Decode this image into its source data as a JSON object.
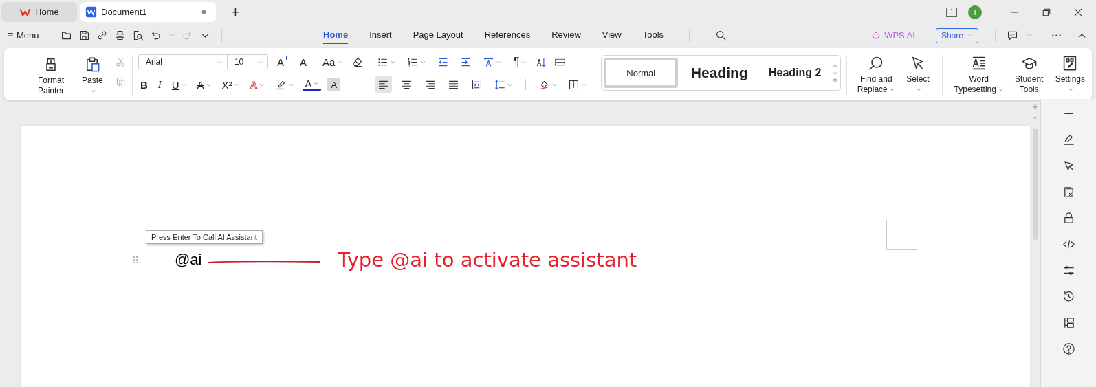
{
  "window_tabs": [
    {
      "label": "Home",
      "kind": "home",
      "selected": false
    },
    {
      "label": "Document1",
      "kind": "doc",
      "selected": true
    }
  ],
  "new_tab": "+",
  "page_count": "1",
  "avatar": "T",
  "menu": "Menu",
  "ribbon_tabs": [
    {
      "label": "Home",
      "selected": true
    },
    {
      "label": "Insert",
      "selected": false
    },
    {
      "label": "Page Layout",
      "selected": false
    },
    {
      "label": "References",
      "selected": false
    },
    {
      "label": "Review",
      "selected": false
    },
    {
      "label": "View",
      "selected": false
    },
    {
      "label": "Tools",
      "selected": false
    }
  ],
  "wps_ai": "WPS AI",
  "share": "Share",
  "clipboard": {
    "format_painter": "Format Painter",
    "paste": "Paste"
  },
  "font": {
    "name": "Arial",
    "size": "10",
    "grow": "A",
    "shrink": "A",
    "change_case": "Aa",
    "bold": "B",
    "italic": "I",
    "underline": "U",
    "strikethrough": "A",
    "superscript": "X²",
    "text_effect": "A",
    "font_color": "A",
    "shading": "A"
  },
  "paragraph": {
    "pilcrow": "¶",
    "alignment": [
      {
        "selected": true
      },
      {
        "selected": false
      },
      {
        "selected": false
      },
      {
        "selected": false
      },
      {
        "selected": false
      }
    ]
  },
  "styles": [
    {
      "label": "Normal",
      "kind": "normal",
      "selected": true
    },
    {
      "label": "Heading",
      "kind": "heading1",
      "selected": false
    },
    {
      "label": "Heading 2",
      "kind": "heading2",
      "selected": false
    }
  ],
  "large_buttons": [
    {
      "label": "Find and Replace",
      "kind": "find",
      "dropdown": true
    },
    {
      "label": "Select",
      "kind": "select",
      "dropdown": true
    },
    {
      "label": "Word Typesetting",
      "kind": "typesetting",
      "dropdown": true
    },
    {
      "label": "Student Tools",
      "kind": "student",
      "dropdown": false
    },
    {
      "label": "Settings",
      "kind": "settings",
      "dropdown": true
    }
  ],
  "document": {
    "tooltip": "Press Enter To Call AI Assistant",
    "text": "@ai",
    "annotation": "Type @ai to activate assistant"
  }
}
